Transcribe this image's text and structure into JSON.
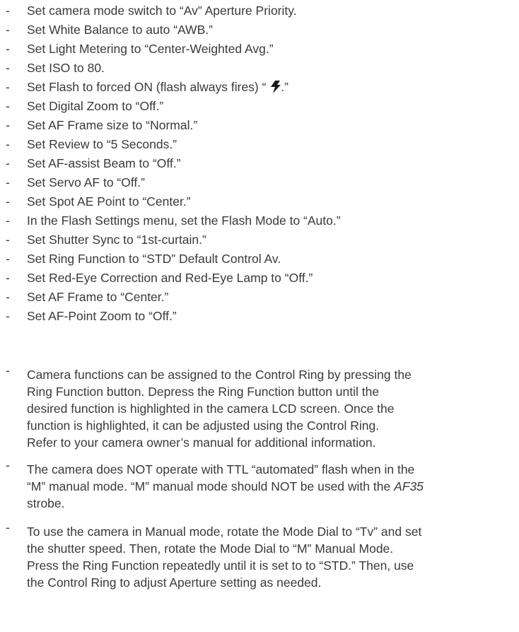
{
  "settings": [
    {
      "dash": "-",
      "text": "Set camera mode switch to  “Av” Aperture Priority."
    },
    {
      "dash": "-",
      "text": "Set White Balance to auto “AWB.”"
    },
    {
      "dash": "-",
      "text": "Set Light Metering to “Center-Weighted Avg.”"
    },
    {
      "dash": "-",
      "text": "Set ISO to 80."
    },
    {
      "dash": "-",
      "text_before": "Set Flash to forced ON (flash always fires) “ ",
      "icon": "flash-bolt-icon",
      "text_after": ".”"
    },
    {
      "dash": "-",
      "text": "Set Digital Zoom to “Off.”"
    },
    {
      "dash": "-",
      "text": "Set AF Frame size to “Normal.”"
    },
    {
      "dash": "-",
      "text": "Set Review to “5 Seconds.”"
    },
    {
      "dash": "-",
      "text": "Set AF-assist Beam to “Off.”"
    },
    {
      "dash": "-",
      "text": "Set Servo AF to “Off.”"
    },
    {
      "dash": "-",
      "text": "Set Spot AE Point to “Center.”"
    },
    {
      "dash": "-",
      "text": "In the Flash Settings menu, set the Flash Mode to “Auto.”"
    },
    {
      "dash": "-",
      "text": "Set Shutter Sync to “1st-curtain.”"
    },
    {
      "dash": "-",
      "text": "Set Ring Function to “STD” Default Control Av."
    },
    {
      "dash": "-",
      "text": "Set Red-Eye Correction and Red-Eye Lamp to “Off.”"
    },
    {
      "dash": "-",
      "text": "Set AF Frame to “Center.”"
    },
    {
      "dash": "-",
      "text": "Set AF-Point Zoom to “Off.”"
    }
  ],
  "notes": [
    {
      "dash": "-",
      "lines": [
        "Camera functions can be assigned to the Control Ring by pressing the",
        "Ring Function button. Depress the Ring Function button until the",
        "desired function is highlighted in the camera LCD screen. Once the",
        "function is highlighted, it can be adjusted using the Control Ring.",
        "Refer to your camera owner’s manual for additional information."
      ]
    },
    {
      "dash": "-",
      "line1": "The camera does NOT operate with TTL “automated” flash when in the",
      "line2_before": "“M” manual mode. “M” manual mode should NOT be used with the ",
      "line2_model": "AF35",
      "line3": "strobe."
    },
    {
      "dash": "-",
      "lines": [
        "To use the camera in Manual mode, rotate the Mode Dial to “Tv” and set",
        "the shutter speed. Then, rotate the Mode Dial to “M” Manual Mode.",
        "Press the Ring Function repeatedly until it is set to to “STD.” Then, use",
        "the Control Ring to adjust Aperture setting as needed."
      ]
    }
  ],
  "colors": {
    "text": "#3a3a3a",
    "icon": "#1a1a1a"
  }
}
